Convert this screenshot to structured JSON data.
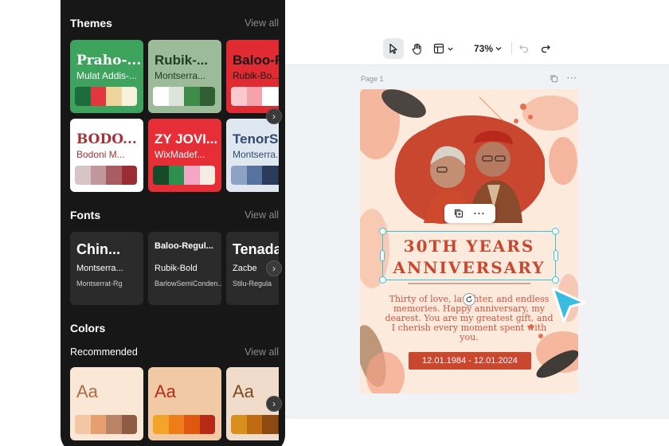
{
  "toolbar": {
    "zoom": "73%"
  },
  "page": {
    "label": "Page 1",
    "more": "···"
  },
  "card": {
    "title_line1": "30TH YEARS",
    "title_line2": "ANNIVERSARY",
    "message": "Thirty of love, laughter, and endless memories. Happy anniversary, my dearest. You are my greatest gift, and I cherish every moment spent with you.",
    "date": "12.01.1984 - 12.01.2024",
    "float_more": "···",
    "accent": "#c9462f",
    "selection_color": "#38c2da"
  },
  "panel": {
    "themes": {
      "title": "Themes",
      "view_all": "View all",
      "items": [
        {
          "big": "Praho-...",
          "sub": "Mulat Addis-...",
          "bg": "#3da35d",
          "fg": "#ffffff",
          "swatches": [
            "#1e6b3b",
            "#e0383e",
            "#efd59b",
            "#f8f1dc"
          ]
        },
        {
          "big": "Rubik-...",
          "sub": "Montserra...",
          "bg": "#9cbb98",
          "fg": "#1f3d22",
          "swatches": [
            "#ffffff",
            "#dde4d9",
            "#3f8b4a",
            "#2e5e32"
          ]
        },
        {
          "big": "Baloo-Regu...",
          "sub": "Rubik-Bo...",
          "bg": "#e02b33",
          "fg": "#1a1a1a",
          "swatches": [
            "#f9c9cf",
            "#f4a2ab",
            "#ffffff",
            "#ffd2dd"
          ]
        },
        {
          "big": "BODO...",
          "sub": "Bodoni M...",
          "bg": "#ffffff",
          "fg": "#a3323b",
          "swatches": [
            "#d7c4c6",
            "#c0979b",
            "#a85c63",
            "#9a2c33"
          ]
        },
        {
          "big": "ZY JOVI...",
          "sub": "WixMadef...",
          "bg": "#e52e36",
          "fg": "#ffffff",
          "swatches": [
            "#164a2b",
            "#2e8f4e",
            "#f5a6c4",
            "#f4ede4"
          ]
        },
        {
          "big": "TenorS...",
          "sub": "Montserra...",
          "bg": "#dfe7f0",
          "fg": "#304a6e",
          "swatches": [
            "#8ea2c4",
            "#5673a0",
            "#2b3b5a",
            "#1f2b42"
          ]
        }
      ]
    },
    "fonts": {
      "title": "Fonts",
      "view_all": "View all",
      "items": [
        {
          "f1": "Chin...",
          "f2": "Montserra...",
          "f3": "Montserrat-Rg"
        },
        {
          "f1": "Baloo-Regul...",
          "f2": "Rubik-Bold",
          "f3": "BarlowSemiConden..."
        },
        {
          "f1": "Tenada",
          "f2": "Zacbe",
          "f3": "Stilu-Regula"
        }
      ]
    },
    "colors": {
      "title": "Colors",
      "recommended": "Recommended",
      "view_all": "View all",
      "items": [
        {
          "aa": "Aa",
          "bg": "#fbe7d6",
          "fg": "#b06b45",
          "swatches": [
            "#f3c7a5",
            "#e6a06f",
            "#b98466",
            "#8f5b44"
          ]
        },
        {
          "aa": "Aa",
          "bg": "#f1c9a5",
          "fg": "#b52a1d",
          "swatches": [
            "#f4a429",
            "#ee7c19",
            "#e0570f",
            "#b62914"
          ]
        },
        {
          "aa": "Aa",
          "bg": "#f1dccb",
          "fg": "#7a4a1f",
          "swatches": [
            "#d88f1c",
            "#c06a12",
            "#8c4913",
            "#5a3414"
          ]
        }
      ]
    },
    "arrow": "›"
  }
}
